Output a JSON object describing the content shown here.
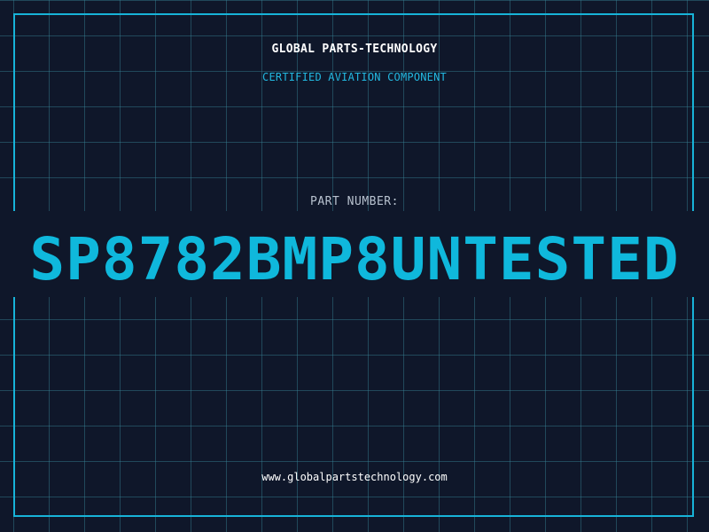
{
  "header": {
    "brand": "GLOBAL PARTS-TECHNOLOGY",
    "subtitle": "CERTIFIED AVIATION COMPONENT"
  },
  "part": {
    "label": "PART NUMBER:",
    "number": "SP8782BMP8UNTESTED"
  },
  "footer": {
    "website": "www.globalpartstechnology.com"
  },
  "colors": {
    "background": "#0f172a",
    "grid": "#2d6a80",
    "accent": "#0fb8dc",
    "frame": "#17b3d8",
    "heading": "#ffffff",
    "label": "#b8c2cf"
  }
}
